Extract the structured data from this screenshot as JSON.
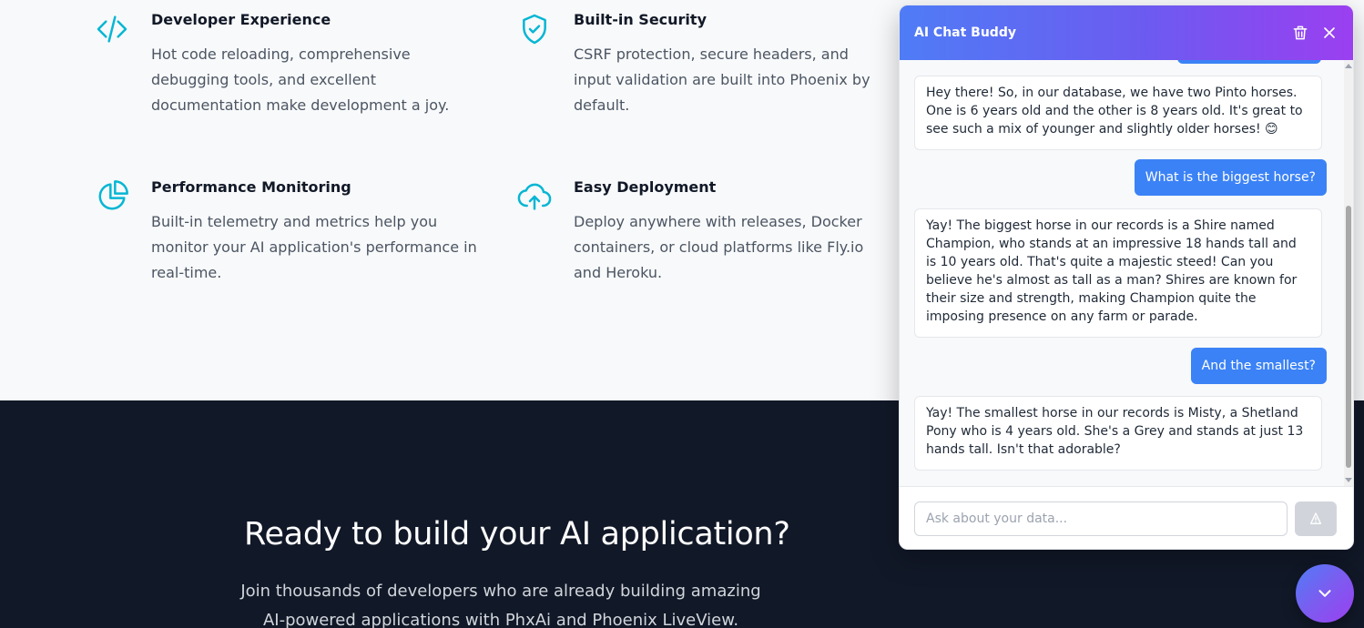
{
  "features": [
    {
      "icon": "code-icon",
      "title": "Developer Experience",
      "description": "Hot code reloading, comprehensive debugging tools, and excellent documentation make development a joy."
    },
    {
      "icon": "shield-check-icon",
      "title": "Built-in Security",
      "description": "CSRF protection, secure headers, and input validation are built into Phoenix by default."
    },
    {
      "icon": "pie-chart-icon",
      "title": "Performance Monitoring",
      "description": "Built-in telemetry and metrics help you monitor your AI application's performance in real-time."
    },
    {
      "icon": "cloud-upload-icon",
      "title": "Easy Deployment",
      "description": "Deploy anywhere with releases, Docker containers, or cloud platforms like Fly.io and Heroku."
    }
  ],
  "cta": {
    "heading": "Ready to build your AI application?",
    "subtext": "Join thousands of developers who are already building amazing AI-powered applications with PhxAi and Phoenix LiveView."
  },
  "chat": {
    "title": "AI Chat Buddy",
    "messages": [
      {
        "role": "assistant",
        "text": "Hey there! So, in our database, we have two Pinto horses. One is 6 years old and the other is 8 years old. It's great to see such a mix of younger and slightly older horses! 😊"
      },
      {
        "role": "user",
        "text": "What is the biggest horse?"
      },
      {
        "role": "assistant",
        "text": "Yay! The biggest horse in our records is a Shire named Champion, who stands at an impressive 18 hands tall and is 10 years old. That's quite a majestic steed! Can you believe he's almost as tall as a man? Shires are known for their size and strength, making Champion quite the imposing presence on any farm or parade."
      },
      {
        "role": "user",
        "text": "And the smallest?"
      },
      {
        "role": "assistant",
        "text": "Yay! The smallest horse in our records is Misty, a Shetland Pony who is 4 years old. She's a Grey and stands at just 13 hands tall. Isn't that adorable?"
      }
    ],
    "input": {
      "placeholder": "Ask about your data...",
      "value": ""
    },
    "colors": {
      "user_bubble": "#3b82f6",
      "accent_start": "#4f7cf6",
      "accent_end": "#9b3ff0"
    }
  }
}
